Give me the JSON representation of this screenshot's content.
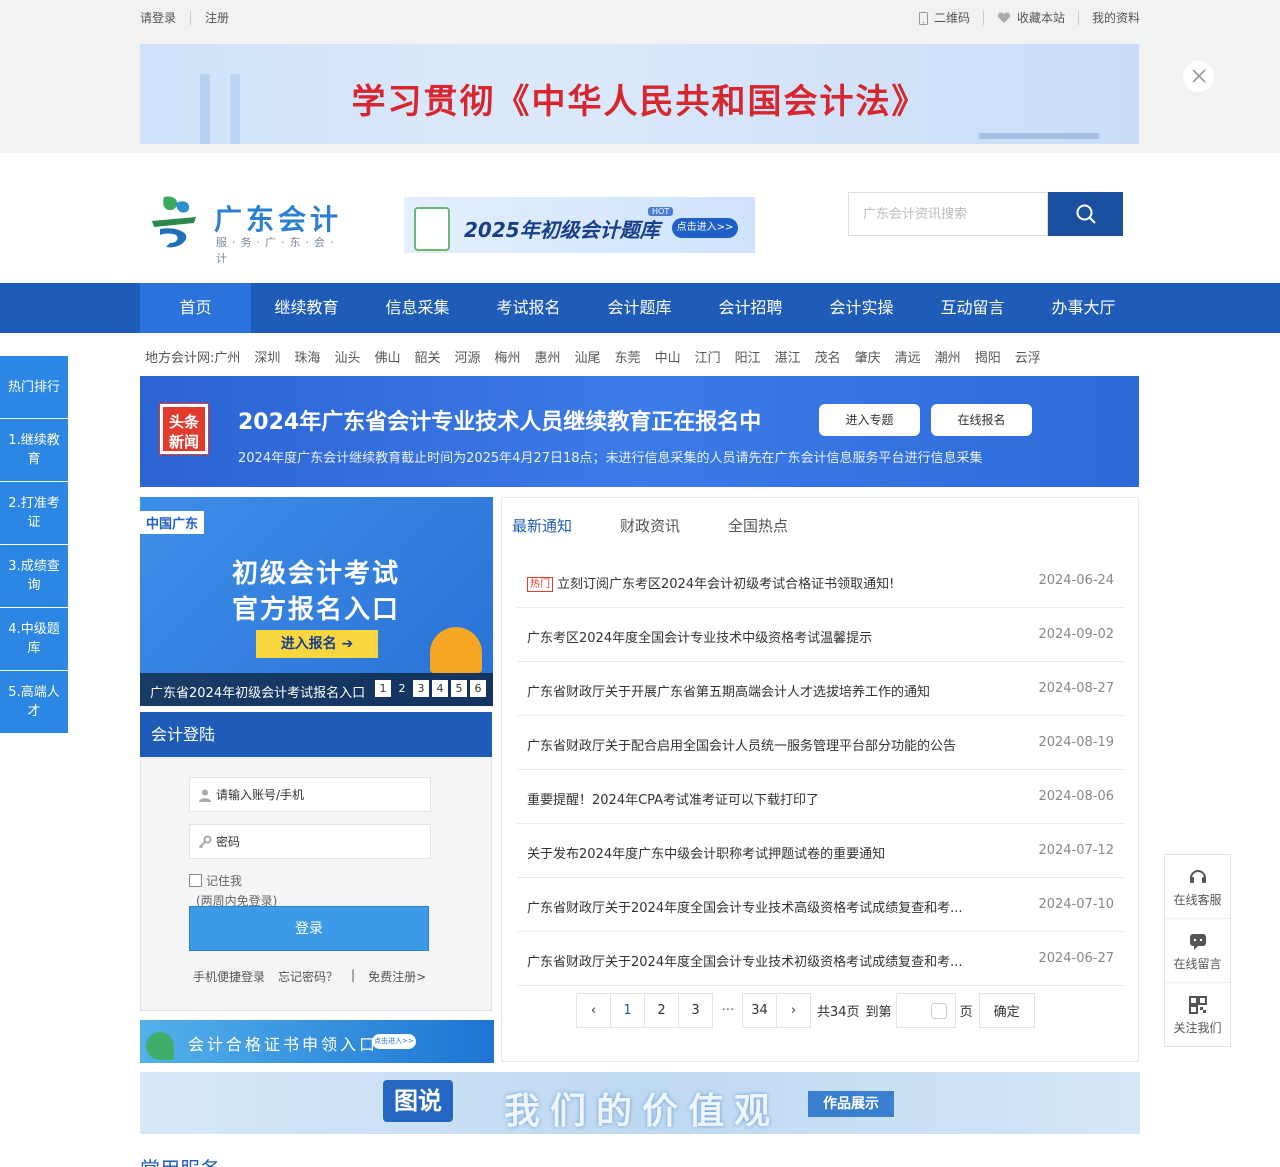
{
  "topbar": {
    "login": "请登录",
    "register": "注册",
    "qrcode": "二维码",
    "favorite": "收藏本站",
    "profile": "我的资料"
  },
  "banner_top": {
    "text": "学习贯彻《中华人民共和国会计法》"
  },
  "logo": {
    "name": "广东会计",
    "sub": "服·务·广·东·会·计"
  },
  "ad_mid": {
    "title": "2025年初级会计题库",
    "hot": "HOT",
    "button": "点击进入>>"
  },
  "search": {
    "placeholder": "广东会计资讯搜索"
  },
  "nav": {
    "items": [
      "首页",
      "继续教育",
      "信息采集",
      "考试报名",
      "会计题库",
      "会计招聘",
      "会计实操",
      "互动留言",
      "办事大厅"
    ]
  },
  "cities": {
    "label": "地方会计网:",
    "items": [
      "广州",
      "深圳",
      "珠海",
      "汕头",
      "佛山",
      "韶关",
      "河源",
      "梅州",
      "惠州",
      "汕尾",
      "东莞",
      "中山",
      "江门",
      "阳江",
      "湛江",
      "茂名",
      "肇庆",
      "清远",
      "潮州",
      "揭阳",
      "云浮"
    ]
  },
  "sidenav": {
    "items": [
      "热门排行",
      "1.继续教育",
      "2.打准考证",
      "3.成绩查询",
      "4.中级题库",
      "5.高端人才"
    ]
  },
  "headline": {
    "badge": "头条新闻",
    "title": "2024年广东省会计专业技术人员继续教育正在报名中",
    "sub": "2024年度广东会计继续教育截止时间为2025年4月27日18点；未进行信息采集的人员请先在广东会计信息服务平台进行信息采集",
    "btn1": "进入专题",
    "btn2": "在线报名"
  },
  "carousel": {
    "tag": "中国广东",
    "line1": "初级会计考试",
    "line2": "官方报名入口",
    "button": "进入报名 ➔",
    "caption": "广东省2024年初级会计考试报名入口",
    "dots": [
      "1",
      "2",
      "3",
      "4",
      "5",
      "6"
    ],
    "current": "2"
  },
  "login": {
    "title": "会计登陆",
    "account_placeholder": "请输入账号/手机",
    "password_placeholder": "密码",
    "remember": "记住我",
    "remember_note": "(两周内免登录)",
    "submit": "登录",
    "mobile_login": "手机便捷登录",
    "forgot": "忘记密码？",
    "sep": "|",
    "free_register": "免费注册>"
  },
  "ad_cert": {
    "text": "会计合格证书申领入口",
    "button": "点击进入>>"
  },
  "news": {
    "tabs": [
      "最新通知",
      "财政资讯",
      "全国热点"
    ],
    "hot_label": "热门",
    "rows": [
      {
        "title": "立刻订阅广东考区2024年会计初级考试合格证书领取通知!",
        "date": "2024-06-24",
        "hot": true
      },
      {
        "title": "广东考区2024年度全国会计专业技术中级资格考试温馨提示",
        "date": "2024-09-02",
        "hot": false
      },
      {
        "title": "广东省财政厅关于开展广东省第五期高端会计人才选拔培养工作的通知",
        "date": "2024-08-27",
        "hot": false
      },
      {
        "title": "广东省财政厅关于配合启用全国会计人员统一服务管理平台部分功能的公告",
        "date": "2024-08-19",
        "hot": false
      },
      {
        "title": "重要提醒！2024年CPA考试准考证可以下载打印了",
        "date": "2024-08-06",
        "hot": false
      },
      {
        "title": "关于发布2024年度广东中级会计职称考试押题试卷的重要通知",
        "date": "2024-07-12",
        "hot": false
      },
      {
        "title": "广东省财政厅关于2024年度全国会计专业技术高级资格考试成绩复查和考...",
        "date": "2024-07-10",
        "hot": false
      },
      {
        "title": "广东省财政厅关于2024年度全国会计专业技术初级资格考试成绩复查和考...",
        "date": "2024-06-27",
        "hot": false
      }
    ]
  },
  "pager": {
    "prev": "‹",
    "next": "›",
    "pages": [
      "1",
      "2",
      "3"
    ],
    "ellipsis": "···",
    "last": "34",
    "total": "共34页",
    "goto": "到第",
    "unit": "页",
    "confirm": "确定"
  },
  "banner_bottom": {
    "tag": "图说",
    "text": "我们的价值观",
    "ribbon": "作品展示"
  },
  "section": {
    "title": "常用服务"
  },
  "float": {
    "items": [
      "在线客服",
      "在线留言",
      "关注我们"
    ]
  },
  "colors": {
    "brand": "#1f5cb8",
    "accent": "#2b87e3",
    "hot": "#e33a2e"
  }
}
